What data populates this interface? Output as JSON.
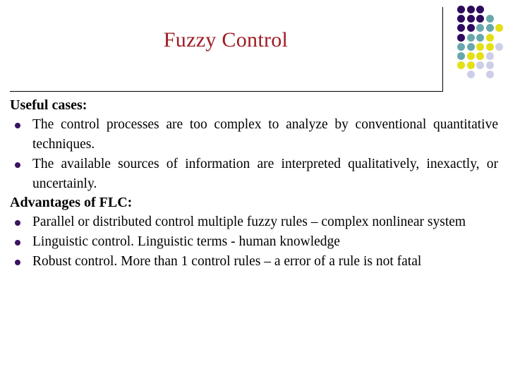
{
  "slide": {
    "title": "Fuzzy Control",
    "title_color": "#9e1b22",
    "background_color": "#ffffff",
    "bullet_color": "#3b1361"
  },
  "sections": [
    {
      "heading": "Useful cases:",
      "bullets": [
        "The control processes are too complex to analyze by conventional quantitative techniques.",
        "The available sources of information are interpreted qualitatively, inexactly, or uncertainly."
      ]
    },
    {
      "heading": "Advantages of FLC:",
      "bullets": [
        "Parallel or distributed control multiple fuzzy rules – complex nonlinear system",
        "Linguistic control. Linguistic terms - human knowledge",
        " Robust control. More than 1 control rules – a error of a rule is not fatal"
      ]
    }
  ],
  "decoration": {
    "dot_grid": {
      "columns": 5,
      "rows": 9,
      "colors": {
        "dark_purple": "#2e0a5e",
        "teal": "#68a8ac",
        "yellow": "#e3e017",
        "lavender": "#cdcfe8"
      },
      "matrix": [
        [
          "dark_purple",
          "dark_purple",
          "dark_purple",
          "",
          ""
        ],
        [
          "dark_purple",
          "dark_purple",
          "dark_purple",
          "teal",
          ""
        ],
        [
          "dark_purple",
          "dark_purple",
          "teal",
          "teal",
          "yellow"
        ],
        [
          "dark_purple",
          "teal",
          "teal",
          "yellow",
          ""
        ],
        [
          "teal",
          "teal",
          "yellow",
          "yellow",
          "lavender"
        ],
        [
          "teal",
          "yellow",
          "yellow",
          "lavender",
          ""
        ],
        [
          "yellow",
          "yellow",
          "lavender",
          "lavender",
          ""
        ],
        [
          "",
          "lavender",
          "",
          "lavender",
          ""
        ],
        [
          "",
          "",
          "",
          "",
          ""
        ]
      ]
    }
  }
}
